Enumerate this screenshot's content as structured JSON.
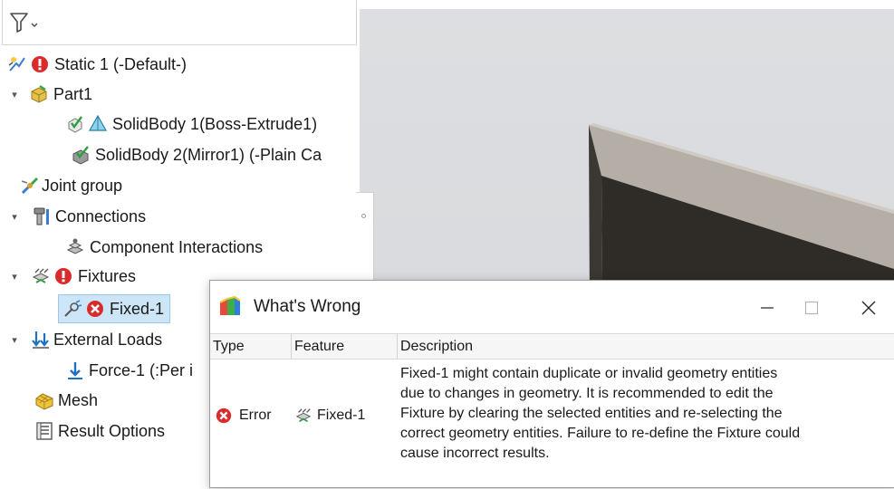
{
  "tree": {
    "items": [
      {
        "label": "Static 1 (-Default-)"
      },
      {
        "label": "Part1"
      },
      {
        "label": "SolidBody 1(Boss-Extrude1)"
      },
      {
        "label": "SolidBody 2(Mirror1) (-Plain Ca"
      },
      {
        "label": "Joint group"
      },
      {
        "label": "Connections"
      },
      {
        "label": "Component Interactions"
      },
      {
        "label": "Fixtures"
      },
      {
        "label": "Fixed-1"
      },
      {
        "label": "External Loads"
      },
      {
        "label": "Force-1 (:Per i"
      },
      {
        "label": "Mesh"
      },
      {
        "label": "Result Options"
      }
    ]
  },
  "dialog": {
    "title": "What's Wrong",
    "columns": [
      "Type",
      "Feature",
      "Description"
    ],
    "row": {
      "type": "Error",
      "feature": "Fixed-1",
      "description_lines": [
        "Fixed-1 might contain duplicate or invalid geometry entities",
        "due to changes in geometry. It is recommended to edit the",
        "Fixture by clearing the selected entities and re-selecting the",
        "correct geometry entities. Failure to re-define the Fixture could",
        "cause incorrect results."
      ]
    }
  },
  "colors": {
    "error_red": "#d92b2b",
    "selection": "#cde6f7",
    "viewport_bg": "#d9dbde",
    "part_dark": "#2e2b27",
    "part_light": "#b4aea6"
  },
  "icons": [
    "filter-icon",
    "study-icon",
    "error-icon",
    "part-icon",
    "solid-body-icon",
    "joint-group-icon",
    "connections-icon",
    "component-interactions-icon",
    "fixtures-icon",
    "fixed-icon",
    "external-loads-icon",
    "force-icon",
    "mesh-icon",
    "result-options-icon",
    "window-app-icon",
    "minimize-icon",
    "maximize-icon",
    "close-icon"
  ]
}
